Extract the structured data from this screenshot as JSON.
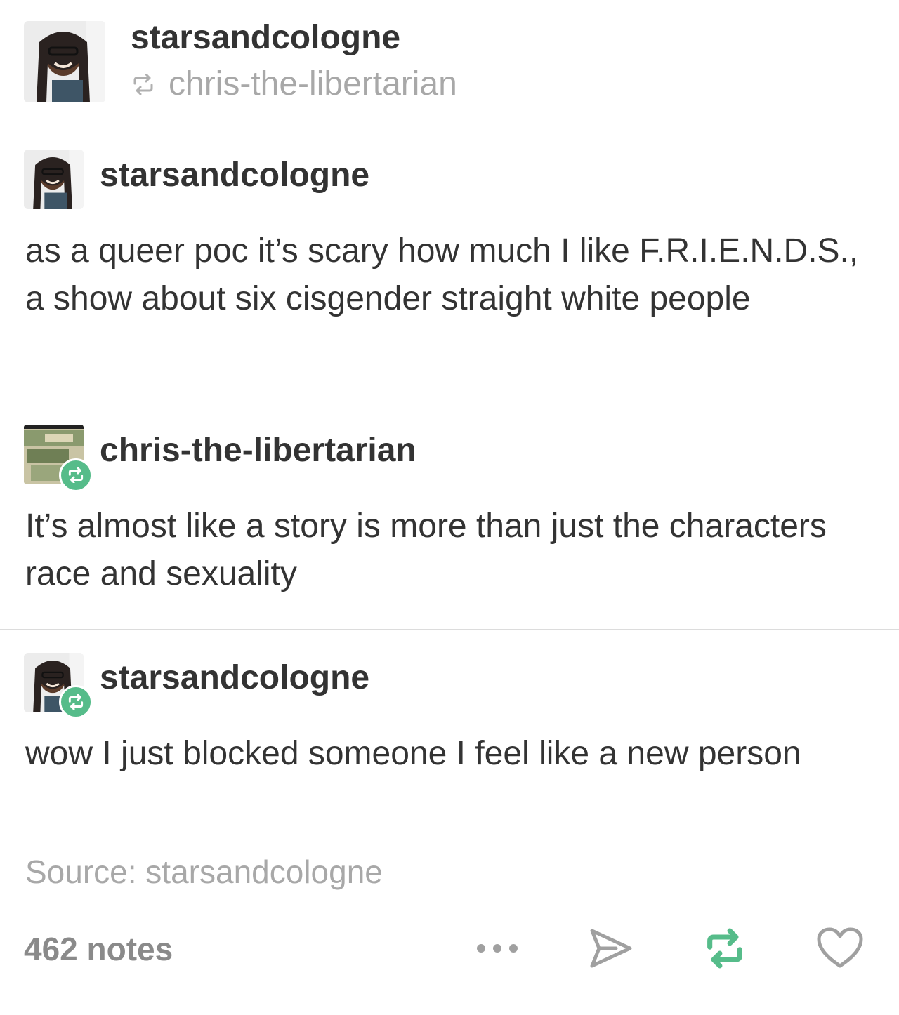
{
  "header": {
    "blog_name": "starsandcologne",
    "reblogged_from": "chris-the-libertarian",
    "reblog_icon": "reblog-icon"
  },
  "thread": [
    {
      "author": "starsandcologne",
      "text": "as a queer poc it’s scary how much I like F.R.I.E.N.D.S., a show about six cisgender straight white people",
      "reblog_badge": false
    },
    {
      "author": "chris-the-libertarian",
      "text": "It’s almost like a story is more than just the characters race and sexuality",
      "reblog_badge": true
    },
    {
      "author": "starsandcologne",
      "text": "wow I just blocked someone I feel like a new person",
      "reblog_badge": true
    }
  ],
  "source": {
    "label": "Source: starsandcologne"
  },
  "footer": {
    "notes": "462 notes",
    "actions": [
      "more-icon",
      "share-icon",
      "reblog-icon",
      "heart-icon"
    ]
  },
  "colors": {
    "reblog_green": "#56bc8a",
    "muted_text": "#a8a8a8",
    "divider": "#dcdcdc"
  }
}
